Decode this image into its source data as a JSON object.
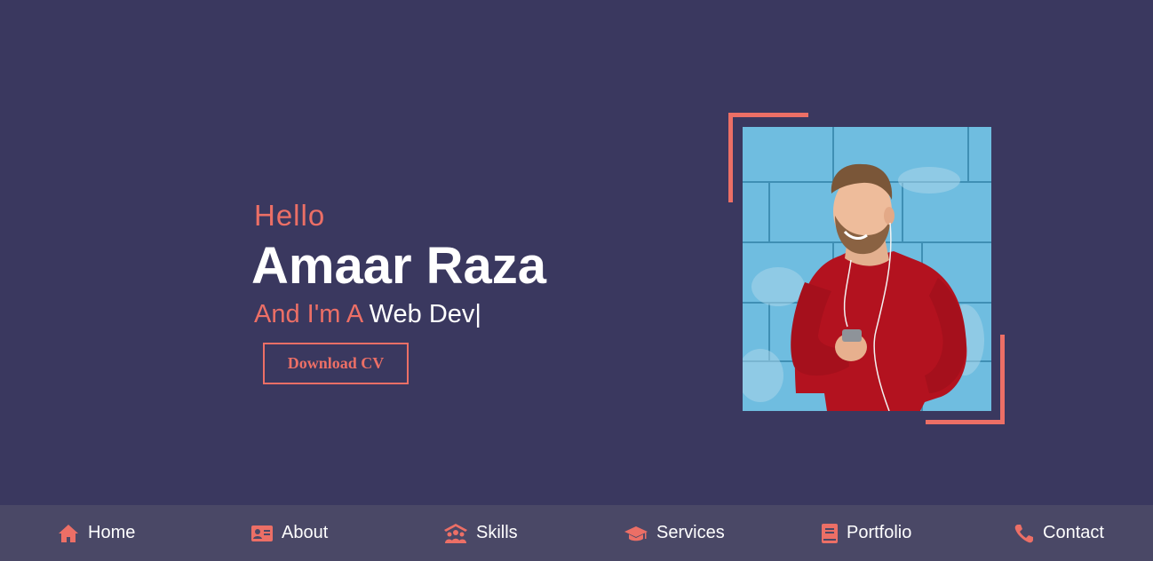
{
  "hero": {
    "greeting": "Hello",
    "name": "Amaar Raza",
    "role_prefix": "And I'm A",
    "role_typed": "Web Dev",
    "cursor": "|",
    "cta_label": "Download CV"
  },
  "nav": {
    "items": [
      {
        "label": "Home",
        "icon": "home-icon"
      },
      {
        "label": "About",
        "icon": "id-card-icon"
      },
      {
        "label": "Skills",
        "icon": "people-icon"
      },
      {
        "label": "Services",
        "icon": "graduation-cap-icon"
      },
      {
        "label": "Portfolio",
        "icon": "book-icon"
      },
      {
        "label": "Contact",
        "icon": "phone-icon"
      }
    ]
  },
  "colors": {
    "background": "#3a385f",
    "accent": "#ec6f66",
    "nav_background": "#4a4866",
    "text": "#ffffff"
  }
}
